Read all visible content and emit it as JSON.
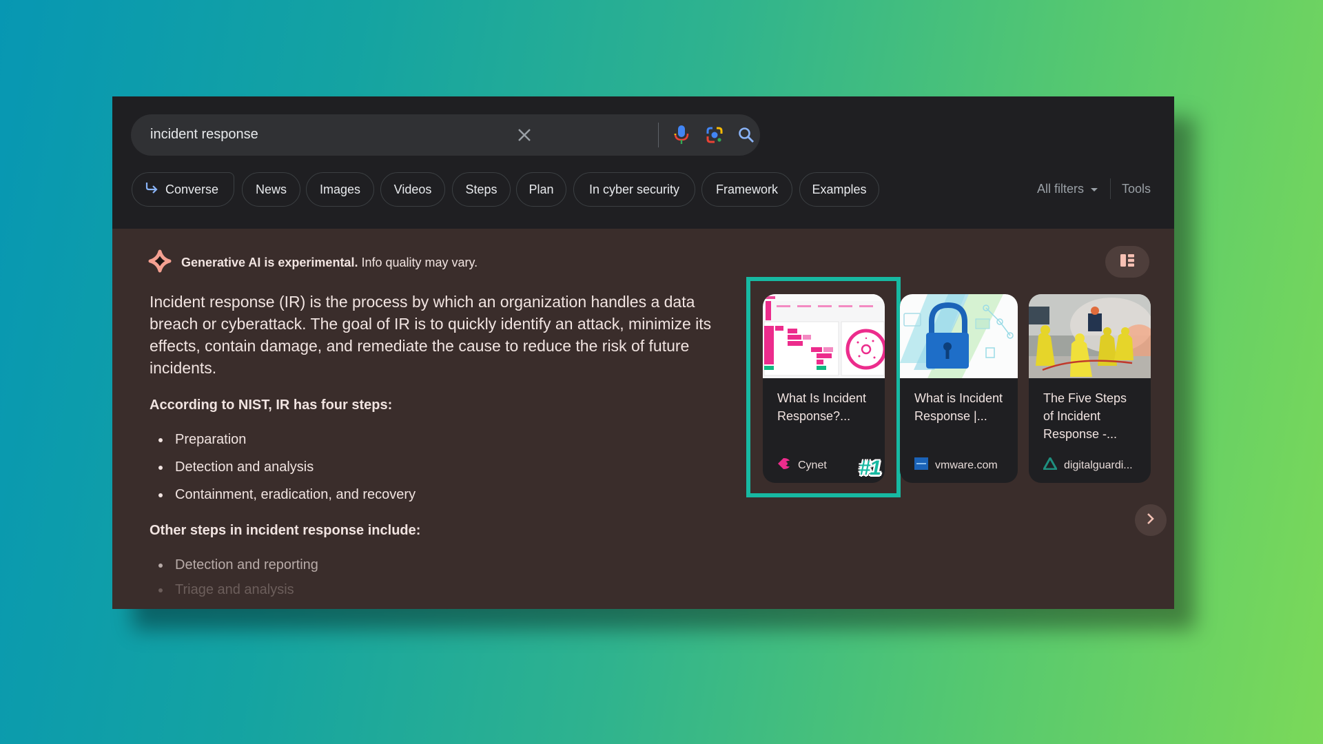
{
  "search": {
    "query": "incident response",
    "icons": [
      "close-icon",
      "microphone-icon",
      "google-lens-icon",
      "search-icon"
    ]
  },
  "chips": [
    {
      "label": "Converse",
      "icon": "converse-arrow-icon"
    },
    {
      "label": "News"
    },
    {
      "label": "Images"
    },
    {
      "label": "Videos"
    },
    {
      "label": "Steps"
    },
    {
      "label": "Plan"
    },
    {
      "label": "In cyber security"
    },
    {
      "label": "Framework"
    },
    {
      "label": "Examples"
    }
  ],
  "filters": {
    "all_filters": "All filters",
    "tools": "Tools"
  },
  "ai_overview": {
    "disclaimer_bold": "Generative AI is experimental.",
    "disclaimer_rest": " Info quality may vary.",
    "lead": "Incident response (IR) is the process by which an organization handles a data breach or cyberattack. The goal of IR is to quickly identify an attack, minimize its effects, contain damage, and remediate the cause to reduce the risk of future incidents.",
    "heading1": "According to NIST, IR has four steps:",
    "nist_steps": [
      "Preparation",
      "Detection and analysis",
      "Containment, eradication, and recovery"
    ],
    "heading2": "Other steps in incident response include:",
    "other_steps": [
      "Detection and reporting",
      "Triage and analysis"
    ]
  },
  "sources": [
    {
      "title": "What Is Incident Response?...",
      "site": "Cynet",
      "badge": "#1",
      "highlighted": true
    },
    {
      "title": "What is Incident Response |...",
      "site": "vmware.com"
    },
    {
      "title": "The Five Steps of Incident Response -...",
      "site": "digitalguardi..."
    }
  ],
  "colors": {
    "highlight": "#17b9a2",
    "ai_background": "#3a2d2b",
    "header_background": "#1f1f22",
    "accent_pink": "#f28b82"
  }
}
